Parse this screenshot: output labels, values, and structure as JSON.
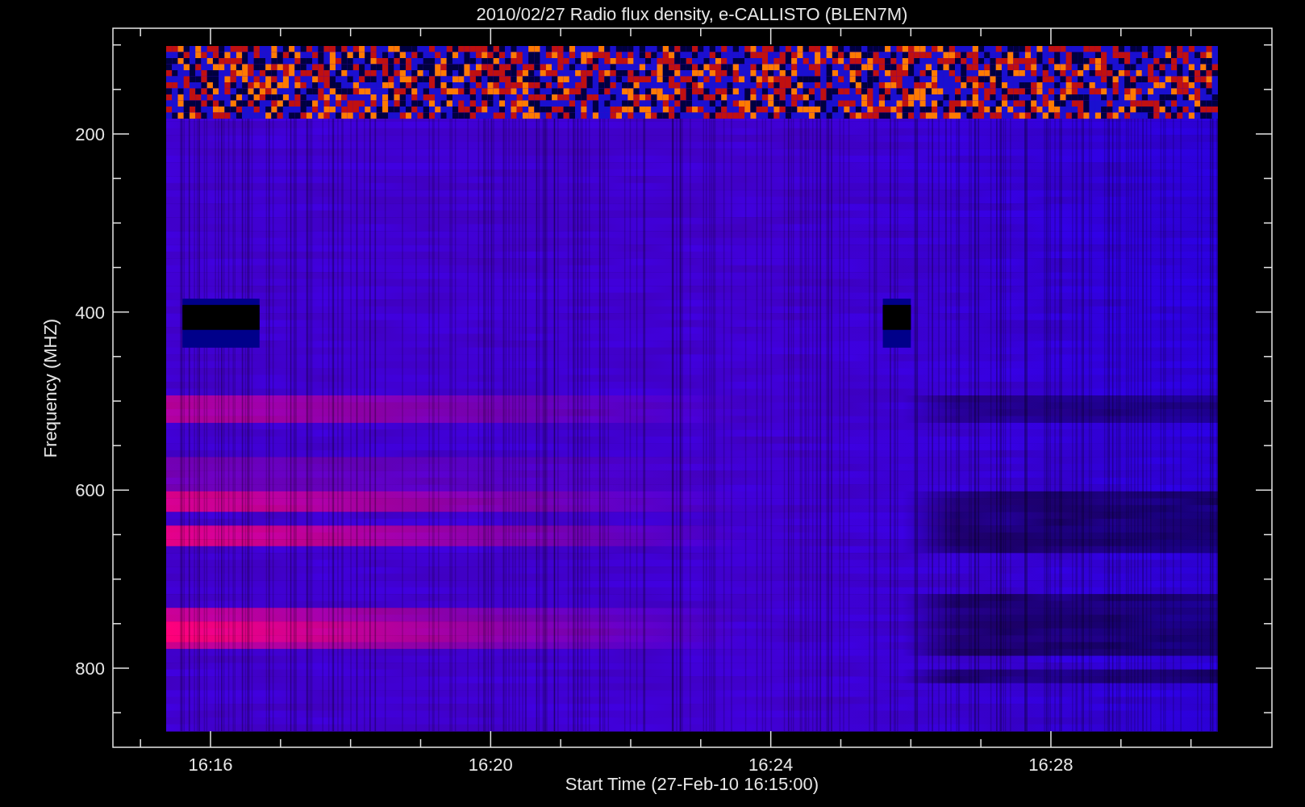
{
  "title": "2010/02/27  Radio flux density, e-CALLISTO (BLEN7M)",
  "y_axis": {
    "label": "Frequency (MHZ)",
    "ticks": [
      "200",
      "400",
      "600",
      "800"
    ]
  },
  "x_axis": {
    "label": "Start Time (27-Feb-10 16:15:00)",
    "ticks": [
      "16:16",
      "16:20",
      "16:24",
      "16:28"
    ]
  }
}
